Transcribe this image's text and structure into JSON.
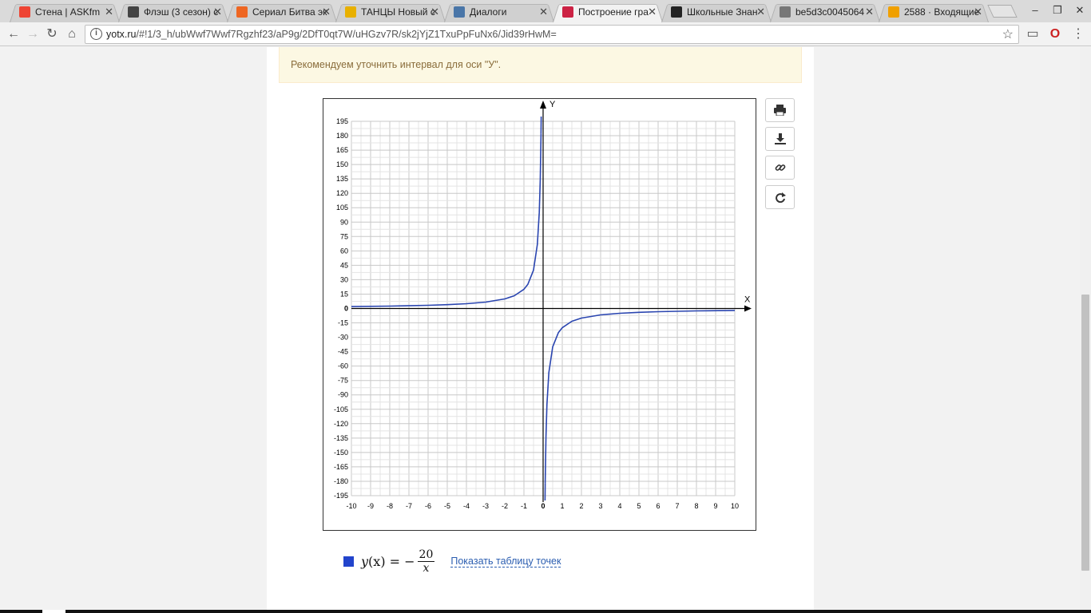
{
  "tabs": [
    {
      "title": "Стена | ASKfm",
      "icon": "askfm-icon",
      "color": "#ee4433"
    },
    {
      "title": "Флэш (3 сезон) с",
      "icon": "flash-icon",
      "color": "#444444"
    },
    {
      "title": "Сериал Битва эк",
      "icon": "fire-icon",
      "color": "#ee6622"
    },
    {
      "title": "ТАНЦЫ Новый с",
      "icon": "tnt-icon",
      "color": "#e8b000"
    },
    {
      "title": "Диалоги",
      "icon": "vk-dialog-icon",
      "color": "#4a76a8"
    },
    {
      "title": "Построение гра",
      "icon": "yotx-icon",
      "color": "#cc2244",
      "active": true
    },
    {
      "title": "Школьные Знан",
      "icon": "znanija-icon",
      "color": "#222222"
    },
    {
      "title": "be5d3c0045064",
      "icon": "document-icon",
      "color": "#777777"
    },
    {
      "title": "2588 · Входящие",
      "icon": "mail-icon",
      "color": "#f0a000"
    }
  ],
  "window_controls": {
    "minimize": "–",
    "maximize": "❐",
    "close": "✕"
  },
  "toolbar": {
    "url_host": "yotx.ru",
    "url_path": "/#!1/3_h/ubWwf7Wwf7Rgzhf23/aP9g/2DfT0qt7W/uHGzv7R/sk2jYjZ1TxuPpFuNx6/Jid39rHwM="
  },
  "warning": {
    "text": "Рекомендуем уточнить интервал для оси \"У\"."
  },
  "side_buttons": {
    "print": "print-icon",
    "download": "download-icon",
    "link": "link-icon",
    "share": "share-icon"
  },
  "legend": {
    "y": "y",
    "x_open": "(x) = −",
    "numerator": "20",
    "denominator": "x",
    "swatch_color": "#2244cc",
    "link_text": "Показать таблицу точек"
  },
  "chart_data": {
    "type": "line",
    "function": "y(x) = -20/x",
    "xlabel": "X",
    "ylabel": "Y",
    "xlim": [
      -10,
      10
    ],
    "ylim": [
      -195,
      195
    ],
    "x_ticks": [
      -10,
      -9,
      -8,
      -7,
      -6,
      -5,
      -4,
      -3,
      -2,
      -1,
      0,
      1,
      2,
      3,
      4,
      5,
      6,
      7,
      8,
      9,
      10
    ],
    "y_ticks": [
      195,
      180,
      165,
      150,
      135,
      120,
      105,
      90,
      75,
      60,
      45,
      30,
      15,
      0,
      -15,
      -30,
      -45,
      -60,
      -75,
      -90,
      -105,
      -120,
      -135,
      -150,
      -165,
      -180,
      -195
    ],
    "grid": true,
    "series_color": "#2a45b0",
    "series": [
      {
        "x": [
          -10,
          -8,
          -6,
          -5,
          -4,
          -3,
          -2,
          -1.5,
          -1,
          -0.8,
          -0.5,
          -0.3,
          -0.2,
          -0.15,
          -0.11
        ],
        "y": [
          2,
          2.5,
          3.33,
          4,
          5,
          6.67,
          10,
          13.33,
          20,
          25,
          40,
          66.67,
          100,
          133.33,
          181.8
        ]
      },
      {
        "x": [
          0.11,
          0.15,
          0.2,
          0.3,
          0.5,
          0.8,
          1,
          1.5,
          2,
          3,
          4,
          5,
          6,
          8,
          10
        ],
        "y": [
          -181.8,
          -133.33,
          -100,
          -66.67,
          -40,
          -25,
          -20,
          -13.33,
          -10,
          -6.67,
          -5,
          -4,
          -3.33,
          -2.5,
          -2
        ]
      }
    ]
  }
}
